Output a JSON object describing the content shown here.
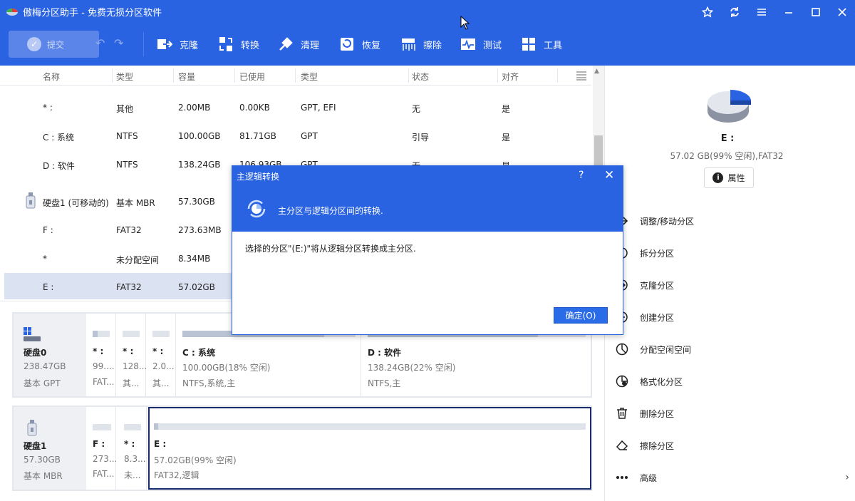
{
  "window": {
    "title": "傲梅分区助手 - 免费无损分区软件"
  },
  "toolbar": {
    "commit_label": "提交",
    "tools": [
      {
        "label": "克隆",
        "icon": "clone-icon"
      },
      {
        "label": "转换",
        "icon": "convert-icon"
      },
      {
        "label": "清理",
        "icon": "cleanup-icon"
      },
      {
        "label": "恢复",
        "icon": "recover-icon"
      },
      {
        "label": "擦除",
        "icon": "wipe-icon"
      },
      {
        "label": "测试",
        "icon": "test-icon"
      },
      {
        "label": "工具",
        "icon": "tools-icon"
      }
    ]
  },
  "table": {
    "headers": [
      "名称",
      "类型",
      "容量",
      "已使用",
      "类型",
      "状态",
      "对齐"
    ],
    "rows": [
      {
        "name": "* :",
        "type": "其他",
        "capacity": "2.00MB",
        "used": "0.00KB",
        "fs": "GPT, EFI",
        "status": "无",
        "align": "是"
      },
      {
        "name": "C : 系统",
        "type": "NTFS",
        "capacity": "100.00GB",
        "used": "81.71GB",
        "fs": "GPT",
        "status": "引导",
        "align": "是"
      },
      {
        "name": "D : 软件",
        "type": "NTFS",
        "capacity": "138.24GB",
        "used": "106.93GB",
        "fs": "GPT",
        "status": "无",
        "align": "是"
      },
      {
        "name": "硬盘1 (可移动的)",
        "type": "基本 MBR",
        "capacity": "57.30GB",
        "used": "",
        "fs": "",
        "status": "",
        "align": ""
      },
      {
        "name": "F :",
        "type": "FAT32",
        "capacity": "273.63MB",
        "used": "",
        "fs": "",
        "status": "",
        "align": ""
      },
      {
        "name": "*",
        "type": "未分配空间",
        "capacity": "8.34MB",
        "used": "",
        "fs": "",
        "status": "",
        "align": ""
      },
      {
        "name": "E :",
        "type": "FAT32",
        "capacity": "57.02GB",
        "used": "",
        "fs": "",
        "status": "",
        "align": ""
      }
    ]
  },
  "disk0": {
    "name": "硬盘0",
    "size": "238.47GB",
    "type": "基本 GPT",
    "parts": [
      {
        "name": "* :",
        "size": "99....",
        "fs": "FAT..."
      },
      {
        "name": "* :",
        "size": "128...",
        "fs": "其..."
      },
      {
        "name": "* :",
        "size": "2.0...",
        "fs": "其..."
      },
      {
        "name": "C : 系统",
        "size": "100.00GB(18% 空闲)",
        "fs": "NTFS,系统,主"
      },
      {
        "name": "D : 软件",
        "size": "138.24GB(22% 空闲)",
        "fs": "NTFS,主"
      }
    ]
  },
  "disk1": {
    "name": "硬盘1",
    "size": "57.30GB",
    "type": "基本 MBR",
    "parts": [
      {
        "name": "F :",
        "size": "273...",
        "fs": "FAT..."
      },
      {
        "name": "* :",
        "size": "8.3...",
        "fs": "未..."
      },
      {
        "name": "E :",
        "size": "57.02GB(99% 空闲)",
        "fs": "FAT32,逻辑"
      }
    ]
  },
  "selected": {
    "name": "E :",
    "info": "57.02 GB(99% 空闲),FAT32",
    "props_label": "属性",
    "used_fraction": 0.01
  },
  "operations": [
    {
      "label": "调整/移动分区",
      "icon": "resize-move-icon"
    },
    {
      "label": "拆分分区",
      "icon": "split-icon"
    },
    {
      "label": "克隆分区",
      "icon": "clone-partition-icon"
    },
    {
      "label": "创建分区",
      "icon": "create-partition-icon"
    },
    {
      "label": "分配空闲空间",
      "icon": "allocate-space-icon"
    },
    {
      "label": "格式化分区",
      "icon": "format-icon"
    },
    {
      "label": "删除分区",
      "icon": "delete-icon"
    },
    {
      "label": "擦除分区",
      "icon": "erase-icon"
    },
    {
      "label": "高级",
      "icon": "more-icon"
    }
  ],
  "dialog": {
    "title": "主逻辑转换",
    "help": "?",
    "close": "✕",
    "description": "主分区与逻辑分区间的转换.",
    "message": "选择的分区\"(E:)\"将从逻辑分区转换成主分区.",
    "ok_label": "确定(O)"
  }
}
